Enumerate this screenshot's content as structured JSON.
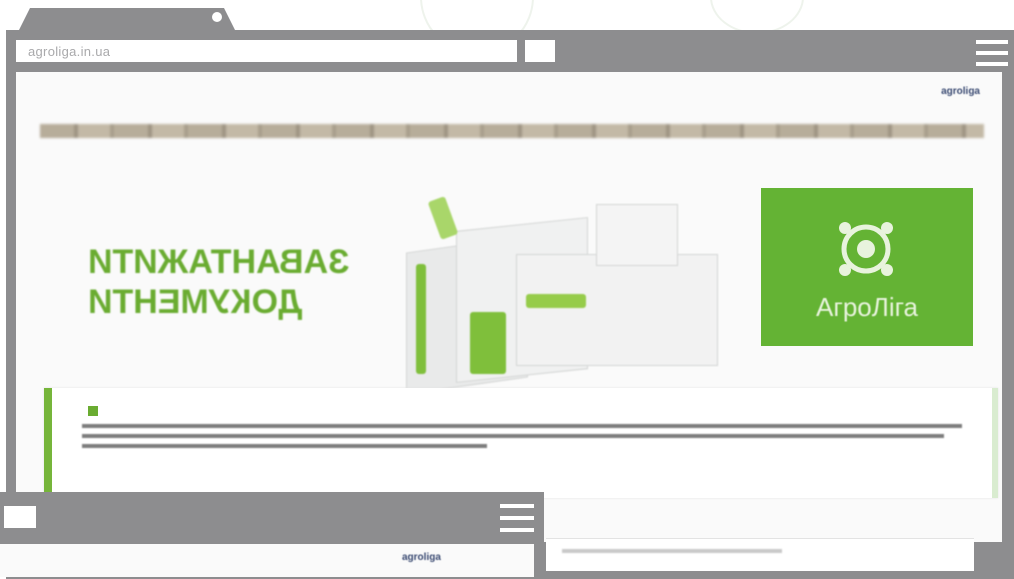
{
  "window": {
    "url": "agroliga.in.ua"
  },
  "site": {
    "logo_text": "agroliga",
    "top_links": [
      "",
      "",
      ""
    ],
    "banner_heading_line1": "ЗАВАНТАЖИТИ",
    "banner_heading_line2": "ДОКУМЕНТИ",
    "brand_card_name": "АгроЛіга",
    "notice": {
      "title": "",
      "line_count_visual": 3
    }
  },
  "window2": {
    "logo_text": "agroliga"
  },
  "colors": {
    "chrome_gray": "#8d8d8f",
    "brand_green": "#64b334",
    "text_green": "#6aac31",
    "logo_navy": "#3a4a72"
  },
  "icons": {
    "menu": "hamburger-icon",
    "emblem": "agroliga-emblem-icon",
    "notice": "green-square-icon"
  }
}
